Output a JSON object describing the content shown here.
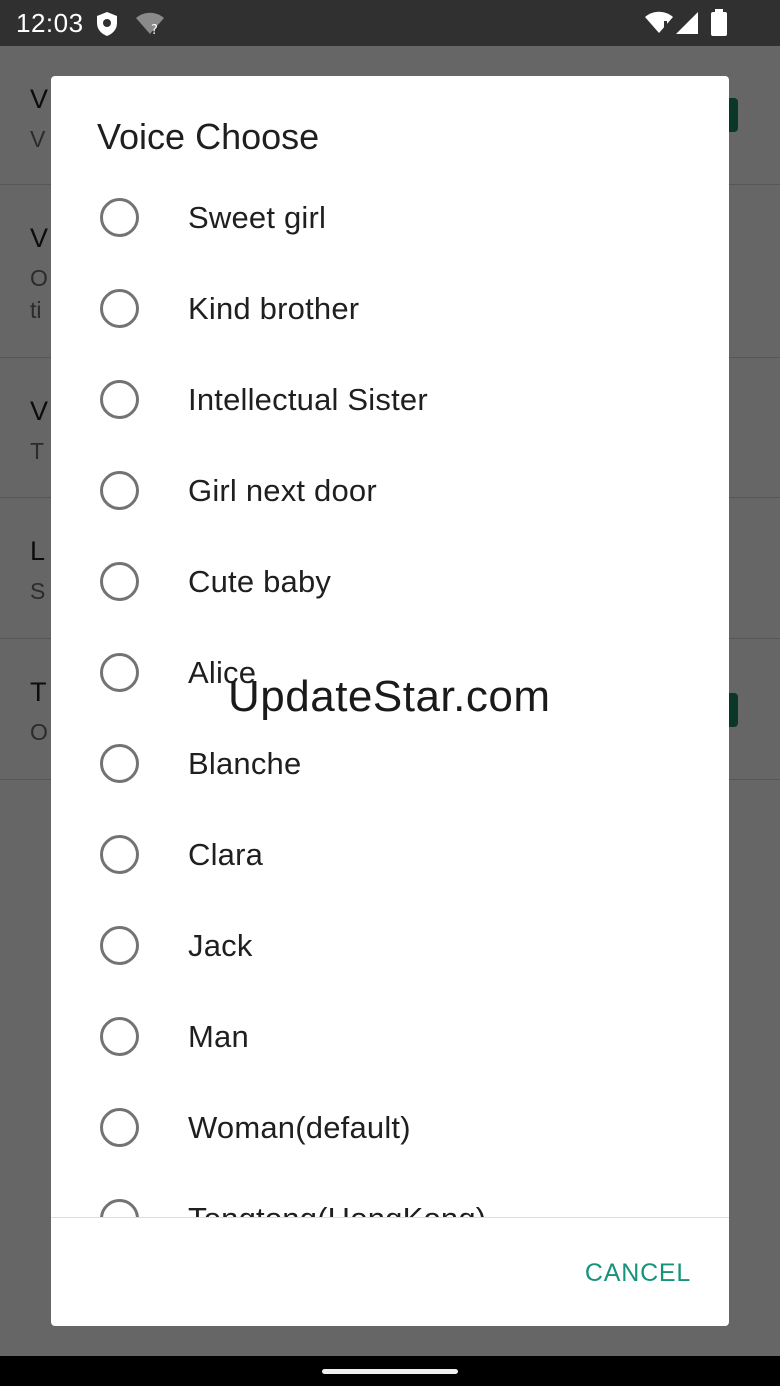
{
  "status_bar": {
    "time": "12:03",
    "icons": [
      "shield-icon",
      "wifi-question-icon",
      "wifi-icon",
      "signal-icon",
      "battery-icon"
    ]
  },
  "background_list": [
    {
      "title": "V",
      "subtitle": "V",
      "has_switch": true
    },
    {
      "title": "V",
      "subtitle": "O",
      "subtitle2": "ti",
      "has_switch": false
    },
    {
      "title": "V",
      "subtitle": "T",
      "has_switch": false
    },
    {
      "title": "L",
      "subtitle": "S",
      "has_switch": false
    },
    {
      "title": "T",
      "subtitle": "O",
      "has_switch": true
    }
  ],
  "dialog": {
    "title": "Voice Choose",
    "options": [
      "Sweet girl",
      "Kind brother",
      "Intellectual Sister",
      "Girl next door",
      "Cute baby",
      "Alice",
      "Blanche",
      "Clara",
      "Jack",
      "Man",
      "Woman(default)",
      "Tongtong(HongKong)"
    ],
    "cancel_label": "CANCEL"
  },
  "watermark": "UpdateStar.com",
  "colors": {
    "accent": "#16937c",
    "status_bar": "#303030",
    "switch": "#1b8a60"
  }
}
